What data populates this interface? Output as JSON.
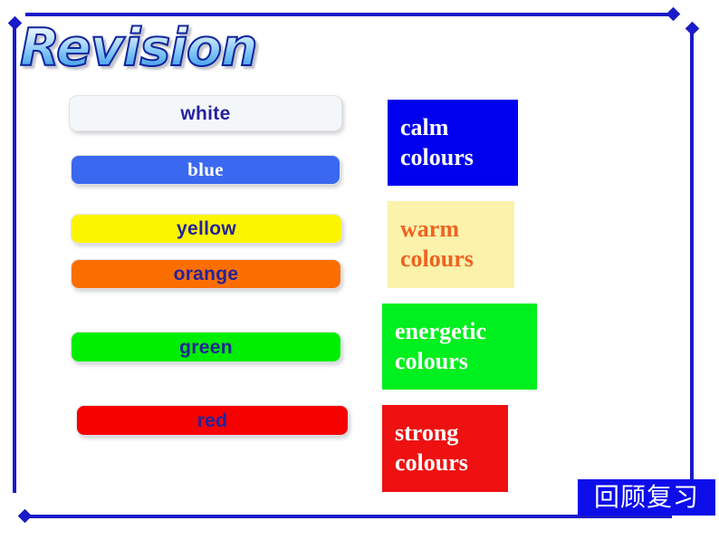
{
  "slide": {
    "title": "Revision",
    "background_color": "#ffffff",
    "frame_color": "#1A1AC8"
  },
  "colour_bars": [
    {
      "name": "white",
      "label": "white",
      "fill": "#f4f7fa",
      "text_color": "#25239b",
      "font": "sans"
    },
    {
      "name": "blue",
      "label": "blue",
      "fill": "#3a68f0",
      "text_color": "#ffffff",
      "font": "serif"
    },
    {
      "name": "yellow",
      "label": "yellow",
      "fill": "#fbf500",
      "text_color": "#25239b",
      "font": "sans"
    },
    {
      "name": "orange",
      "label": "orange",
      "fill": "#fa6e00",
      "text_color": "#25239b",
      "font": "sans"
    },
    {
      "name": "green",
      "label": "green",
      "fill": "#00ef00",
      "text_color": "#25239b",
      "font": "sans"
    },
    {
      "name": "red",
      "label": "red",
      "fill": "#f60000",
      "text_color": "#25239b",
      "font": "sans"
    }
  ],
  "colour_blocks": [
    {
      "name": "calm",
      "line1": "calm",
      "line2": "colours",
      "fill": "#0000ee",
      "text_color": "#ffffff"
    },
    {
      "name": "warm",
      "line1": "warm",
      "line2": "colours",
      "fill": "#fbf2ab",
      "text_color": "#ef6321"
    },
    {
      "name": "energetic",
      "line1": "energetic",
      "line2": "colours",
      "fill": "#00ef1e",
      "text_color": "#ffffff"
    },
    {
      "name": "strong",
      "line1": "strong",
      "line2": "colours",
      "fill": "#ef1111",
      "text_color": "#ffffff"
    }
  ],
  "badge": {
    "text": "回顾复习",
    "fill": "#0d0dea",
    "text_color": "#ffffff"
  }
}
